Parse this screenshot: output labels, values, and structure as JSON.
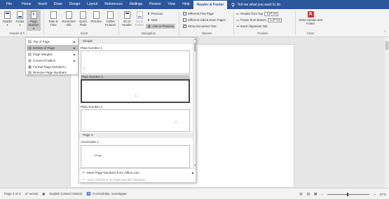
{
  "tabs": [
    {
      "label": "File"
    },
    {
      "label": "Home"
    },
    {
      "label": "Insert"
    },
    {
      "label": "Draw"
    },
    {
      "label": "Design"
    },
    {
      "label": "Layout"
    },
    {
      "label": "References"
    },
    {
      "label": "Mailings"
    },
    {
      "label": "Review"
    },
    {
      "label": "View"
    },
    {
      "label": "Help"
    },
    {
      "label": "Header & Footer"
    }
  ],
  "tell_me": "Tell me what you want to do",
  "ribbon": {
    "header_label": "Header",
    "footer_label": "Footer",
    "page_number_label": "Page Number",
    "date_time_label": "Date & Time",
    "document_info_label": "Document Info",
    "quick_parts_label": "Quick Parts",
    "pictures_label": "Pictures",
    "online_pictures_label": "Online Pictures",
    "go_to_header_label": "Go to Header",
    "go_to_footer_label": "Go to Footer",
    "previous_label": "Previous",
    "next_label": "Next",
    "link_to_previous_label": "Link to Previous",
    "different_first_page": "Different First Page",
    "different_odd_even": "Different Odd & Even Pages",
    "show_document_text": "Show Document Text",
    "header_from_top_label": "Header from Top",
    "header_from_top_value": "1,27 cm",
    "footer_from_bottom_label": "Footer from Bottom",
    "footer_from_bottom_value": "1,27 cm",
    "insert_alignment_tab": "Insert Alignment Tab",
    "close_label": "Close Header and Footer",
    "groups": {
      "header_footer": "Header & F...",
      "insert": "Insert",
      "navigation": "Navigation",
      "options": "Options",
      "position": "Position",
      "close": "Close"
    }
  },
  "page_number_menu": {
    "items": [
      {
        "label": "Top of Page",
        "icon": "page-top-icon"
      },
      {
        "label": "Bottom of Page",
        "icon": "page-bottom-icon"
      },
      {
        "label": "Page Margins",
        "icon": "page-margins-icon"
      },
      {
        "label": "Current Position",
        "icon": "current-position-icon"
      },
      {
        "label": "Format Page Numbers...",
        "icon": "format-page-numbers-icon"
      },
      {
        "label": "Remove Page Numbers",
        "icon": "remove-page-numbers-icon"
      }
    ]
  },
  "gallery": {
    "section_simple": "Simple",
    "items": [
      {
        "title": "Plain Number 1",
        "number": "1"
      },
      {
        "title": "Plain Number 2",
        "number": "1"
      },
      {
        "title": "Plain Number 3",
        "number": "1"
      }
    ],
    "section_page_x": "Page X",
    "accent_bar_title": "Accent Bar 1",
    "accent_bar_text": "1|Page",
    "more_label": "More Page Numbers from Office.com",
    "save_label": "Save Selection as Page Number (Bottom)"
  },
  "status": {
    "page": "Page 2 of 3",
    "words": "47 words",
    "language": "English (United States)",
    "accessibility": "Accessibility: Investigate",
    "zoom": "87%"
  }
}
